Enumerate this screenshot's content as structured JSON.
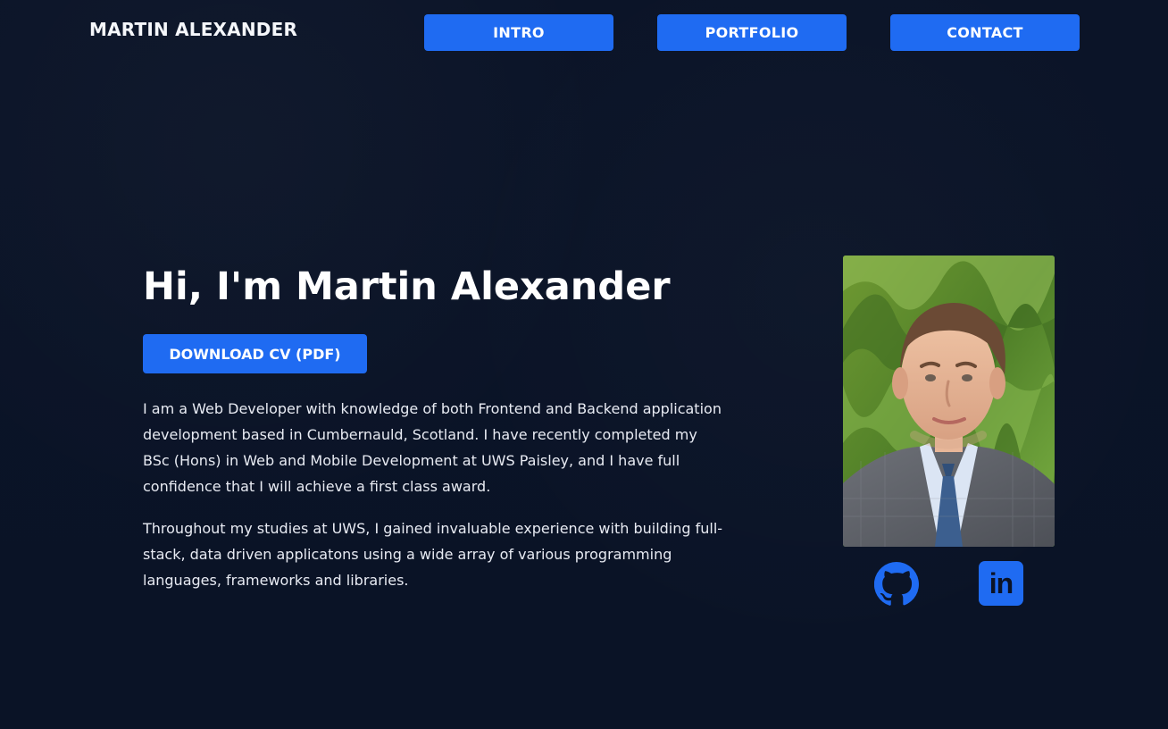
{
  "header": {
    "brand": "MARTIN ALEXANDER",
    "nav": {
      "intro": "INTRO",
      "portfolio": "PORTFOLIO",
      "contact": "CONTACT"
    }
  },
  "hero": {
    "title": "Hi, I'm Martin Alexander",
    "download_cv_label": "DOWNLOAD CV (PDF)",
    "paragraph_1": "I am a Web Developer with knowledge of both Frontend and Backend application development based in Cumbernauld, Scotland. I have recently completed my BSc (Hons) in Web and Mobile Development at UWS Paisley, and I have full confidence that I will achieve a first class award.",
    "paragraph_2": "Throughout my studies at UWS, I gained invaluable experience with building full-stack, data driven applicatons using a wide array of various programming languages, frameworks and libraries."
  },
  "social": {
    "github_icon": "github-icon",
    "linkedin_icon": "linkedin-icon",
    "linkedin_text": "in"
  },
  "theme": {
    "background": "#0b1326",
    "accent": "#1f6bf2",
    "text": "#ffffff"
  }
}
